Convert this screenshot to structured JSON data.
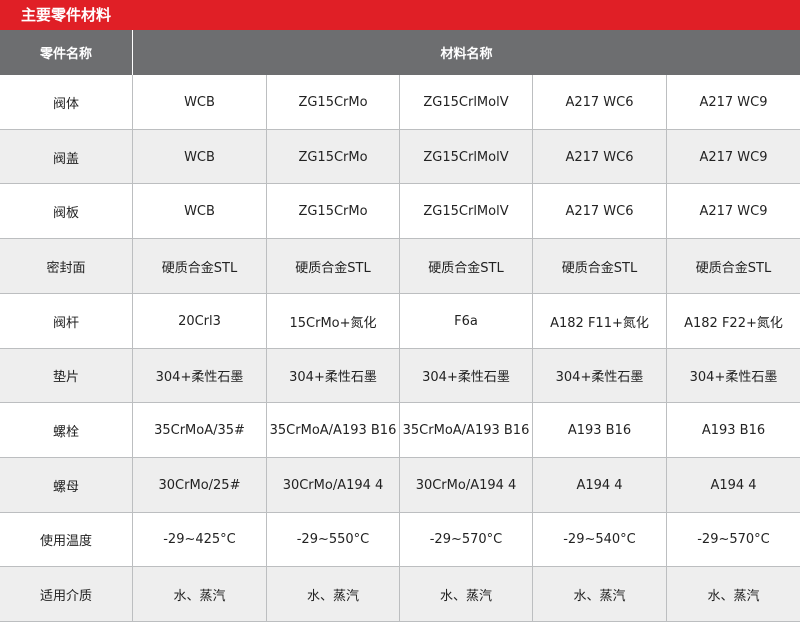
{
  "title": "主要零件材料",
  "table": {
    "header_part": "零件名称",
    "header_material": "材料名称",
    "rows": [
      {
        "part": "阀体",
        "materials": [
          "WCB",
          "ZG15CrMo",
          "ZG15CrlMolV",
          "A217 WC6",
          "A217 WC9"
        ]
      },
      {
        "part": "阀盖",
        "materials": [
          "WCB",
          "ZG15CrMo",
          "ZG15CrlMolV",
          "A217 WC6",
          "A217 WC9"
        ]
      },
      {
        "part": "阀板",
        "materials": [
          "WCB",
          "ZG15CrMo",
          "ZG15CrlMolV",
          "A217 WC6",
          "A217 WC9"
        ]
      },
      {
        "part": "密封面",
        "materials": [
          "硬质合金STL",
          "硬质合金STL",
          "硬质合金STL",
          "硬质合金STL",
          "硬质合金STL"
        ]
      },
      {
        "part": "阀杆",
        "materials": [
          "20Crl3",
          "15CrMo+氮化",
          "F6a",
          "A182 F11+氮化",
          "A182 F22+氮化"
        ]
      },
      {
        "part": "垫片",
        "materials": [
          "304+柔性石墨",
          "304+柔性石墨",
          "304+柔性石墨",
          "304+柔性石墨",
          "304+柔性石墨"
        ]
      },
      {
        "part": "螺栓",
        "materials": [
          "35CrMoA/35#",
          "35CrMoA/A193 B16",
          "35CrMoA/A193 B16",
          "A193 B16",
          "A193 B16"
        ]
      },
      {
        "part": "螺母",
        "materials": [
          "30CrMo/25#",
          "30CrMo/A194 4",
          "30CrMo/A194 4",
          "A194 4",
          "A194 4"
        ]
      },
      {
        "part": "使用温度",
        "materials": [
          "-29~425°C",
          "-29~550°C",
          "-29~570°C",
          "-29~540°C",
          "-29~570°C"
        ]
      },
      {
        "part": "适用介质",
        "materials": [
          "水、蒸汽",
          "水、蒸汽",
          "水、蒸汽",
          "水、蒸汽",
          "水、蒸汽"
        ]
      }
    ]
  },
  "colors": {
    "title_bar": "#e01f26",
    "header": "#6d6e70",
    "alt_row": "#eeeeee"
  }
}
